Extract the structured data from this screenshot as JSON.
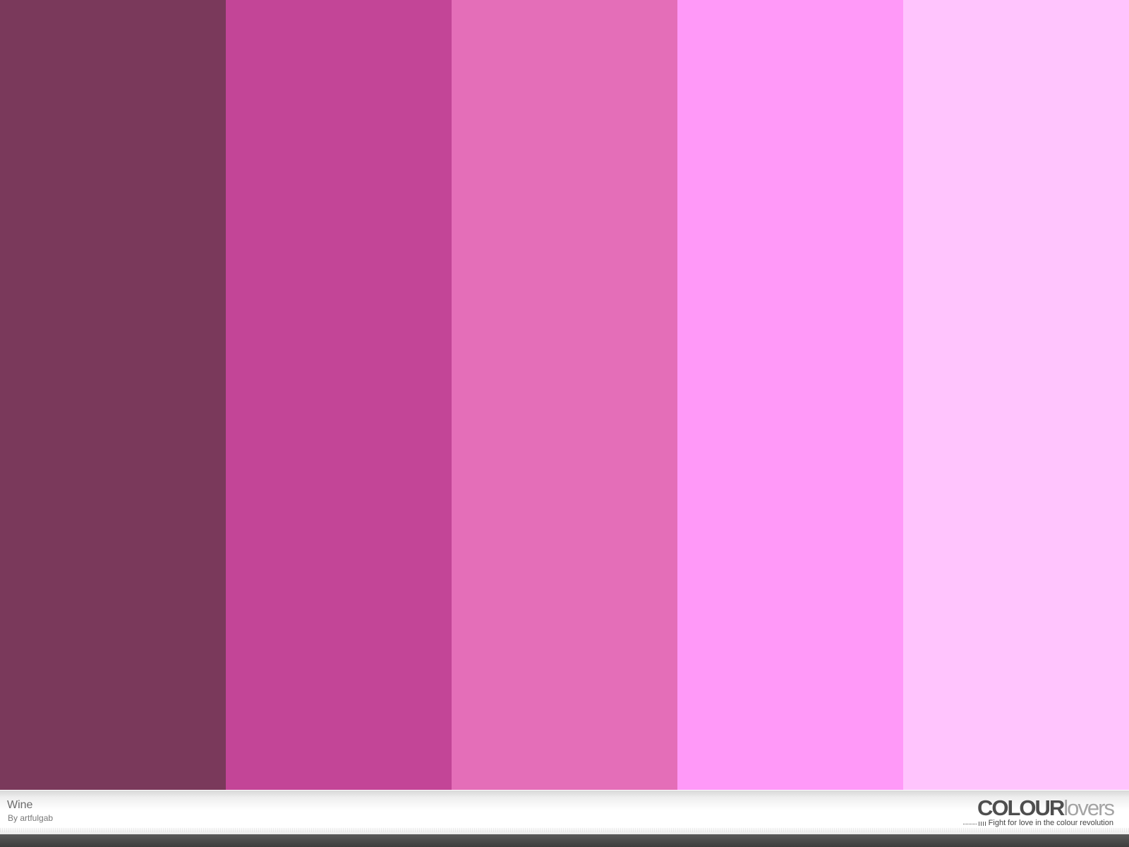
{
  "palette": {
    "title": "Wine",
    "author": "By artfulgab",
    "colors": [
      {
        "hex": "#7a395b"
      },
      {
        "hex": "#c34597"
      },
      {
        "hex": "#e46eb8"
      },
      {
        "hex": "#ff99f8"
      },
      {
        "hex": "#ffc4fd"
      }
    ]
  },
  "branding": {
    "logo_colour": "COLOUR",
    "logo_lovers": "lovers",
    "tagline": "Fight for love in the colour revolution"
  }
}
